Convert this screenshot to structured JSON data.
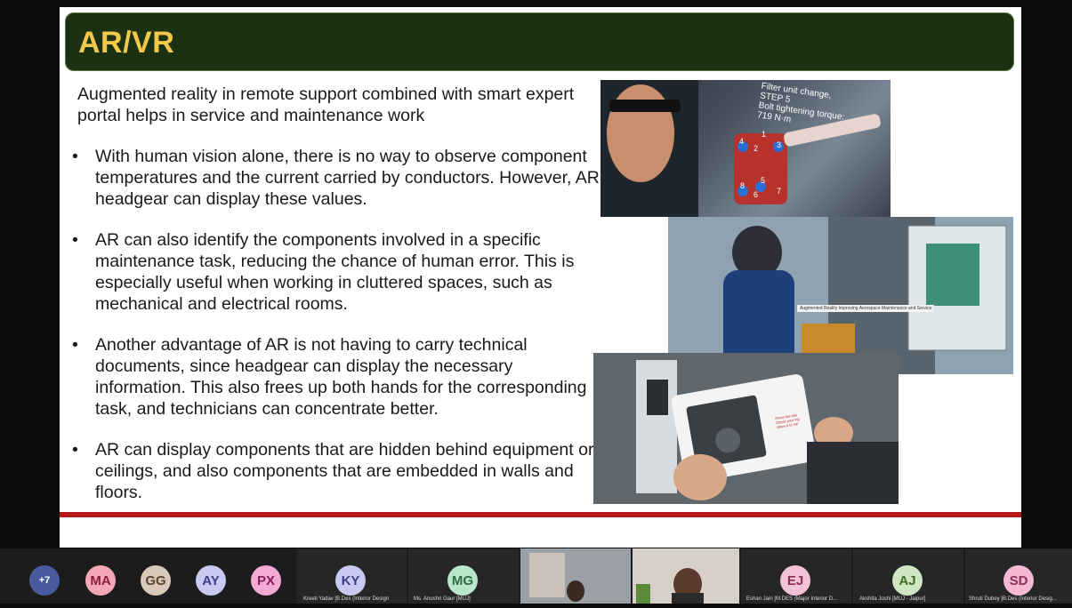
{
  "slide": {
    "title": "AR/VR",
    "intro": "Augmented reality in remote support combined with smart expert portal helps in service and maintenance work",
    "bullets": [
      "With human vision alone, there is no way to observe component temperatures and the current carried by conductors. However, AR headgear can display these values.",
      "AR can also identify the components involved in a specific maintenance task, reducing the chance of human error. This is especially useful when working in cluttered spaces, such as mechanical and electrical rooms.",
      "Another advantage of AR is not having to carry technical documents, since headgear can display the necessary information. This also frees up both hands for the corresponding task, and technicians can concentrate better.",
      "AR can display components that are hidden behind equipment or ceilings, and also components that are embedded in walls and floors."
    ],
    "image1_overlay": "Filter unit change,\nSTEP 5\nBolt tightening torque:\n719 N·m",
    "image1_numbers": [
      "1",
      "2",
      "3",
      "4",
      "5",
      "6",
      "7",
      "8"
    ],
    "image2_caption": "Augmented Reality Improving Aerospace Maintenance and Service",
    "image3_tablet_text": "Press this key\nCheck your log\nShow it to me"
  },
  "colors": {
    "title_bg": "#1c3112",
    "title_text": "#f2c94c",
    "rule": "#b31b1b",
    "meeting_bar": "#1c1c1c"
  },
  "participants": {
    "overflow_count": "+7",
    "small": [
      {
        "initials": "MA",
        "color": "#f4a7b9"
      },
      {
        "initials": "GG",
        "color": "#d9c9b8"
      },
      {
        "initials": "AY",
        "color": "#c9c9f2"
      },
      {
        "initials": "PX",
        "color": "#f2a9d3"
      }
    ],
    "tiles": [
      {
        "initials": "KY",
        "name": "Kreeti Yadav [B.Des (Interior Design",
        "color": "#c9c9f2"
      },
      {
        "initials": "MG",
        "name": "Ms. Anushri Gaur [MUJ]",
        "color": "#b8e8c9"
      },
      {
        "initials": "EJ",
        "name": "Eshan Jain [M.DES (Major Interior D...",
        "color": "#f4c2d6"
      },
      {
        "initials": "AJ",
        "name": "Akshita Joshi [MUJ - Jaipur]",
        "color": "#cfe6c2"
      },
      {
        "initials": "SD",
        "name": "Shruti Dubey [B.Des (Interior Desig...",
        "color": "#f4b8d2"
      }
    ]
  }
}
